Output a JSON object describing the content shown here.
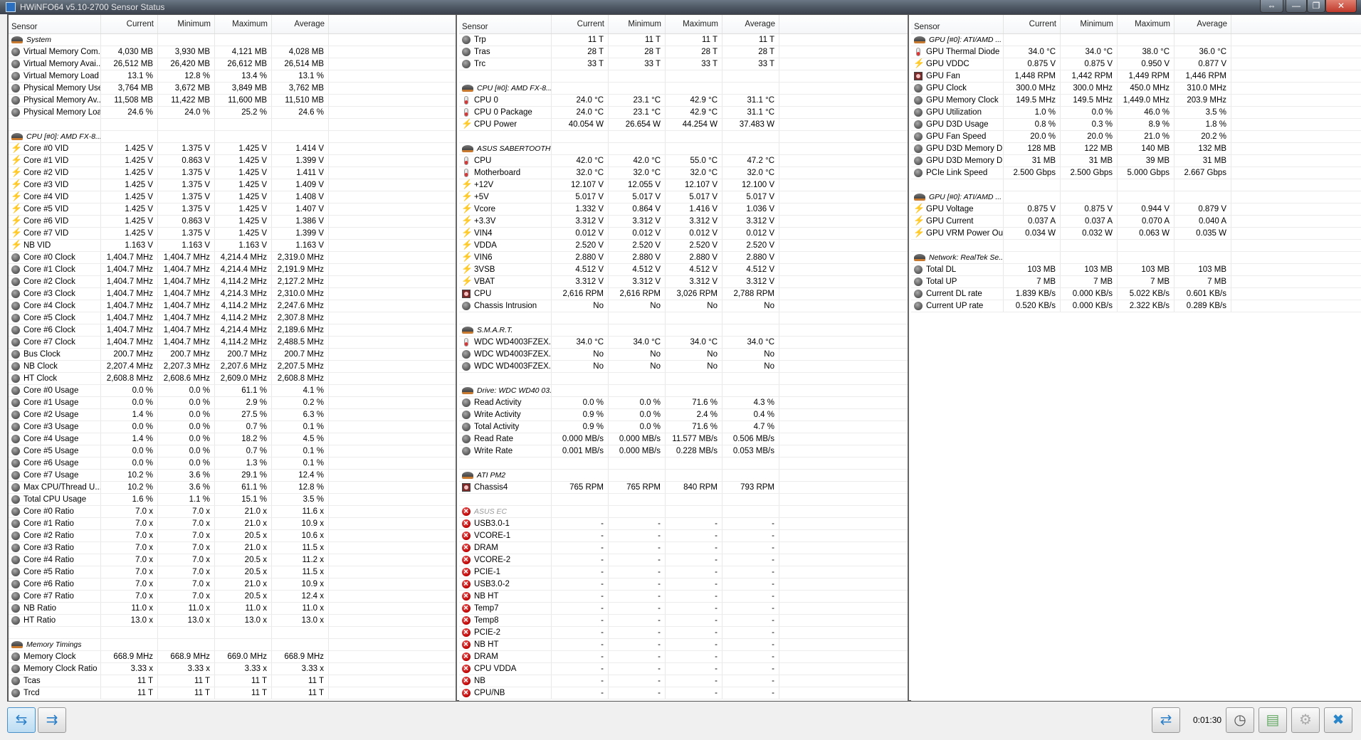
{
  "window": {
    "title": "HWiNFO64 v5.10-2700 Sensor Status",
    "btn_resize": "⇔",
    "btn_min": "—",
    "btn_max": "❐",
    "btn_close": "✕"
  },
  "columns": [
    "Sensor",
    "Current",
    "Minimum",
    "Maximum",
    "Average"
  ],
  "panels": [
    {
      "rows": [
        [
          "S",
          "System"
        ],
        [
          "g",
          "Virtual Memory Com...",
          "4,030 MB",
          "3,930 MB",
          "4,121 MB",
          "4,028 MB"
        ],
        [
          "g",
          "Virtual Memory Avai...",
          "26,512 MB",
          "26,420 MB",
          "26,612 MB",
          "26,514 MB"
        ],
        [
          "g",
          "Virtual Memory Load",
          "13.1 %",
          "12.8 %",
          "13.4 %",
          "13.1 %"
        ],
        [
          "g",
          "Physical Memory Used",
          "3,764 MB",
          "3,672 MB",
          "3,849 MB",
          "3,762 MB"
        ],
        [
          "g",
          "Physical Memory Av...",
          "11,508 MB",
          "11,422 MB",
          "11,600 MB",
          "11,510 MB"
        ],
        [
          "g",
          "Physical Memory Load",
          "24.6 %",
          "24.0 %",
          "25.2 %",
          "24.6 %"
        ],
        [
          "E"
        ],
        [
          "S",
          "CPU [#0]: AMD FX-8..."
        ],
        [
          "b",
          "Core #0 VID",
          "1.425 V",
          "1.375 V",
          "1.425 V",
          "1.414 V"
        ],
        [
          "b",
          "Core #1 VID",
          "1.425 V",
          "0.863 V",
          "1.425 V",
          "1.399 V"
        ],
        [
          "b",
          "Core #2 VID",
          "1.425 V",
          "1.375 V",
          "1.425 V",
          "1.411 V"
        ],
        [
          "b",
          "Core #3 VID",
          "1.425 V",
          "1.375 V",
          "1.425 V",
          "1.409 V"
        ],
        [
          "b",
          "Core #4 VID",
          "1.425 V",
          "1.375 V",
          "1.425 V",
          "1.408 V"
        ],
        [
          "b",
          "Core #5 VID",
          "1.425 V",
          "1.375 V",
          "1.425 V",
          "1.407 V"
        ],
        [
          "b",
          "Core #6 VID",
          "1.425 V",
          "0.863 V",
          "1.425 V",
          "1.386 V"
        ],
        [
          "b",
          "Core #7 VID",
          "1.425 V",
          "1.375 V",
          "1.425 V",
          "1.399 V"
        ],
        [
          "b",
          "NB VID",
          "1.163 V",
          "1.163 V",
          "1.163 V",
          "1.163 V"
        ],
        [
          "g",
          "Core #0 Clock",
          "1,404.7 MHz",
          "1,404.7 MHz",
          "4,214.4 MHz",
          "2,319.0 MHz"
        ],
        [
          "g",
          "Core #1 Clock",
          "1,404.7 MHz",
          "1,404.7 MHz",
          "4,214.4 MHz",
          "2,191.9 MHz"
        ],
        [
          "g",
          "Core #2 Clock",
          "1,404.7 MHz",
          "1,404.7 MHz",
          "4,114.2 MHz",
          "2,127.2 MHz"
        ],
        [
          "g",
          "Core #3 Clock",
          "1,404.7 MHz",
          "1,404.7 MHz",
          "4,214.3 MHz",
          "2,310.0 MHz"
        ],
        [
          "g",
          "Core #4 Clock",
          "1,404.7 MHz",
          "1,404.7 MHz",
          "4,114.2 MHz",
          "2,247.6 MHz"
        ],
        [
          "g",
          "Core #5 Clock",
          "1,404.7 MHz",
          "1,404.7 MHz",
          "4,114.2 MHz",
          "2,307.8 MHz"
        ],
        [
          "g",
          "Core #6 Clock",
          "1,404.7 MHz",
          "1,404.7 MHz",
          "4,214.4 MHz",
          "2,189.6 MHz"
        ],
        [
          "g",
          "Core #7 Clock",
          "1,404.7 MHz",
          "1,404.7 MHz",
          "4,114.2 MHz",
          "2,488.5 MHz"
        ],
        [
          "g",
          "Bus Clock",
          "200.7 MHz",
          "200.7 MHz",
          "200.7 MHz",
          "200.7 MHz"
        ],
        [
          "g",
          "NB Clock",
          "2,207.4 MHz",
          "2,207.3 MHz",
          "2,207.6 MHz",
          "2,207.5 MHz"
        ],
        [
          "g",
          "HT Clock",
          "2,608.8 MHz",
          "2,608.6 MHz",
          "2,609.0 MHz",
          "2,608.8 MHz"
        ],
        [
          "g",
          "Core #0 Usage",
          "0.0 %",
          "0.0 %",
          "61.1 %",
          "4.1 %"
        ],
        [
          "g",
          "Core #1 Usage",
          "0.0 %",
          "0.0 %",
          "2.9 %",
          "0.2 %"
        ],
        [
          "g",
          "Core #2 Usage",
          "1.4 %",
          "0.0 %",
          "27.5 %",
          "6.3 %"
        ],
        [
          "g",
          "Core #3 Usage",
          "0.0 %",
          "0.0 %",
          "0.7 %",
          "0.1 %"
        ],
        [
          "g",
          "Core #4 Usage",
          "1.4 %",
          "0.0 %",
          "18.2 %",
          "4.5 %"
        ],
        [
          "g",
          "Core #5 Usage",
          "0.0 %",
          "0.0 %",
          "0.7 %",
          "0.1 %"
        ],
        [
          "g",
          "Core #6 Usage",
          "0.0 %",
          "0.0 %",
          "1.3 %",
          "0.1 %"
        ],
        [
          "g",
          "Core #7 Usage",
          "10.2 %",
          "3.6 %",
          "29.1 %",
          "12.4 %"
        ],
        [
          "g",
          "Max CPU/Thread U...",
          "10.2 %",
          "3.6 %",
          "61.1 %",
          "12.8 %"
        ],
        [
          "g",
          "Total CPU Usage",
          "1.6 %",
          "1.1 %",
          "15.1 %",
          "3.5 %"
        ],
        [
          "g",
          "Core #0 Ratio",
          "7.0 x",
          "7.0 x",
          "21.0 x",
          "11.6 x"
        ],
        [
          "g",
          "Core #1 Ratio",
          "7.0 x",
          "7.0 x",
          "21.0 x",
          "10.9 x"
        ],
        [
          "g",
          "Core #2 Ratio",
          "7.0 x",
          "7.0 x",
          "20.5 x",
          "10.6 x"
        ],
        [
          "g",
          "Core #3 Ratio",
          "7.0 x",
          "7.0 x",
          "21.0 x",
          "11.5 x"
        ],
        [
          "g",
          "Core #4 Ratio",
          "7.0 x",
          "7.0 x",
          "20.5 x",
          "11.2 x"
        ],
        [
          "g",
          "Core #5 Ratio",
          "7.0 x",
          "7.0 x",
          "20.5 x",
          "11.5 x"
        ],
        [
          "g",
          "Core #6 Ratio",
          "7.0 x",
          "7.0 x",
          "21.0 x",
          "10.9 x"
        ],
        [
          "g",
          "Core #7 Ratio",
          "7.0 x",
          "7.0 x",
          "20.5 x",
          "12.4 x"
        ],
        [
          "g",
          "NB Ratio",
          "11.0 x",
          "11.0 x",
          "11.0 x",
          "11.0 x"
        ],
        [
          "g",
          "HT Ratio",
          "13.0 x",
          "13.0 x",
          "13.0 x",
          "13.0 x"
        ],
        [
          "E"
        ],
        [
          "S",
          "Memory Timings"
        ],
        [
          "g",
          "Memory Clock",
          "668.9 MHz",
          "668.9 MHz",
          "669.0 MHz",
          "668.9 MHz"
        ],
        [
          "g",
          "Memory Clock Ratio",
          "3.33 x",
          "3.33 x",
          "3.33 x",
          "3.33 x"
        ],
        [
          "g",
          "Tcas",
          "11 T",
          "11 T",
          "11 T",
          "11 T"
        ],
        [
          "g",
          "Trcd",
          "11 T",
          "11 T",
          "11 T",
          "11 T"
        ]
      ]
    },
    {
      "rows": [
        [
          "g",
          "Trp",
          "11 T",
          "11 T",
          "11 T",
          "11 T"
        ],
        [
          "g",
          "Tras",
          "28 T",
          "28 T",
          "28 T",
          "28 T"
        ],
        [
          "g",
          "Trc",
          "33 T",
          "33 T",
          "33 T",
          "33 T"
        ],
        [
          "E"
        ],
        [
          "S",
          "CPU [#0]: AMD FX-8..."
        ],
        [
          "t",
          "CPU 0",
          "24.0 °C",
          "23.1 °C",
          "42.9 °C",
          "31.1 °C"
        ],
        [
          "t",
          "CPU 0 Package",
          "24.0 °C",
          "23.1 °C",
          "42.9 °C",
          "31.1 °C"
        ],
        [
          "b",
          "CPU Power",
          "40.054 W",
          "26.654 W",
          "44.254 W",
          "37.483 W"
        ],
        [
          "E"
        ],
        [
          "S",
          "ASUS SABERTOOTH ..."
        ],
        [
          "t",
          "CPU",
          "42.0 °C",
          "42.0 °C",
          "55.0 °C",
          "47.2 °C"
        ],
        [
          "t",
          "Motherboard",
          "32.0 °C",
          "32.0 °C",
          "32.0 °C",
          "32.0 °C"
        ],
        [
          "b",
          "+12V",
          "12.107 V",
          "12.055 V",
          "12.107 V",
          "12.100 V"
        ],
        [
          "b",
          "+5V",
          "5.017 V",
          "5.017 V",
          "5.017 V",
          "5.017 V"
        ],
        [
          "b",
          "Vcore",
          "1.332 V",
          "0.864 V",
          "1.416 V",
          "1.036 V"
        ],
        [
          "b",
          "+3.3V",
          "3.312 V",
          "3.312 V",
          "3.312 V",
          "3.312 V"
        ],
        [
          "b",
          "VIN4",
          "0.012 V",
          "0.012 V",
          "0.012 V",
          "0.012 V"
        ],
        [
          "b",
          "VDDA",
          "2.520 V",
          "2.520 V",
          "2.520 V",
          "2.520 V"
        ],
        [
          "b",
          "VIN6",
          "2.880 V",
          "2.880 V",
          "2.880 V",
          "2.880 V"
        ],
        [
          "b",
          "3VSB",
          "4.512 V",
          "4.512 V",
          "4.512 V",
          "4.512 V"
        ],
        [
          "b",
          "VBAT",
          "3.312 V",
          "3.312 V",
          "3.312 V",
          "3.312 V"
        ],
        [
          "f",
          "CPU",
          "2,616 RPM",
          "2,616 RPM",
          "3,026 RPM",
          "2,788 RPM"
        ],
        [
          "g",
          "Chassis Intrusion",
          "No",
          "No",
          "No",
          "No"
        ],
        [
          "E"
        ],
        [
          "S",
          "S.M.A.R.T."
        ],
        [
          "t",
          "WDC WD4003FZEX...",
          "34.0 °C",
          "34.0 °C",
          "34.0 °C",
          "34.0 °C"
        ],
        [
          "g",
          "WDC WD4003FZEX...",
          "No",
          "No",
          "No",
          "No"
        ],
        [
          "g",
          "WDC WD4003FZEX...",
          "No",
          "No",
          "No",
          "No"
        ],
        [
          "E"
        ],
        [
          "S",
          "Drive: WDC WD40 03..."
        ],
        [
          "g",
          "Read Activity",
          "0.0 %",
          "0.0 %",
          "71.6 %",
          "4.3 %"
        ],
        [
          "g",
          "Write Activity",
          "0.9 %",
          "0.0 %",
          "2.4 %",
          "0.4 %"
        ],
        [
          "g",
          "Total Activity",
          "0.9 %",
          "0.0 %",
          "71.6 %",
          "4.7 %"
        ],
        [
          "g",
          "Read Rate",
          "0.000 MB/s",
          "0.000 MB/s",
          "11.577 MB/s",
          "0.506 MB/s"
        ],
        [
          "g",
          "Write Rate",
          "0.001 MB/s",
          "0.000 MB/s",
          "0.228 MB/s",
          "0.053 MB/s"
        ],
        [
          "E"
        ],
        [
          "S",
          "ATI PM2"
        ],
        [
          "f",
          "Chassis4",
          "765 RPM",
          "765 RPM",
          "840 RPM",
          "793 RPM"
        ],
        [
          "E"
        ],
        [
          "D",
          "ASUS EC"
        ],
        [
          "x",
          "USB3.0-1",
          "-",
          "-",
          "-",
          "-"
        ],
        [
          "x",
          "VCORE-1",
          "-",
          "-",
          "-",
          "-"
        ],
        [
          "x",
          "DRAM",
          "-",
          "-",
          "-",
          "-"
        ],
        [
          "x",
          "VCORE-2",
          "-",
          "-",
          "-",
          "-"
        ],
        [
          "x",
          "PCIE-1",
          "-",
          "-",
          "-",
          "-"
        ],
        [
          "x",
          "USB3.0-2",
          "-",
          "-",
          "-",
          "-"
        ],
        [
          "x",
          "NB HT",
          "-",
          "-",
          "-",
          "-"
        ],
        [
          "x",
          "Temp7",
          "-",
          "-",
          "-",
          "-"
        ],
        [
          "x",
          "Temp8",
          "-",
          "-",
          "-",
          "-"
        ],
        [
          "x",
          "PCIE-2",
          "-",
          "-",
          "-",
          "-"
        ],
        [
          "x",
          "NB HT",
          "-",
          "-",
          "-",
          "-"
        ],
        [
          "x",
          "DRAM",
          "-",
          "-",
          "-",
          "-"
        ],
        [
          "x",
          "CPU VDDA",
          "-",
          "-",
          "-",
          "-"
        ],
        [
          "x",
          "NB",
          "-",
          "-",
          "-",
          "-"
        ],
        [
          "x",
          "CPU/NB",
          "-",
          "-",
          "-",
          "-"
        ]
      ]
    },
    {
      "rows": [
        [
          "S",
          "GPU [#0]: ATI/AMD ..."
        ],
        [
          "t",
          "GPU Thermal Diode",
          "34.0 °C",
          "34.0 °C",
          "38.0 °C",
          "36.0 °C"
        ],
        [
          "b",
          "GPU VDDC",
          "0.875 V",
          "0.875 V",
          "0.950 V",
          "0.877 V"
        ],
        [
          "f",
          "GPU Fan",
          "1,448 RPM",
          "1,442 RPM",
          "1,449 RPM",
          "1,446 RPM"
        ],
        [
          "g",
          "GPU Clock",
          "300.0 MHz",
          "300.0 MHz",
          "450.0 MHz",
          "310.0 MHz"
        ],
        [
          "g",
          "GPU Memory Clock",
          "149.5 MHz",
          "149.5 MHz",
          "1,449.0 MHz",
          "203.9 MHz"
        ],
        [
          "g",
          "GPU Utilization",
          "1.0 %",
          "0.0 %",
          "46.0 %",
          "3.5 %"
        ],
        [
          "g",
          "GPU D3D Usage",
          "0.8 %",
          "0.3 %",
          "8.9 %",
          "1.8 %"
        ],
        [
          "g",
          "GPU Fan Speed",
          "20.0 %",
          "20.0 %",
          "21.0 %",
          "20.2 %"
        ],
        [
          "g",
          "GPU D3D Memory D...",
          "128 MB",
          "122 MB",
          "140 MB",
          "132 MB"
        ],
        [
          "g",
          "GPU D3D Memory D...",
          "31 MB",
          "31 MB",
          "39 MB",
          "31 MB"
        ],
        [
          "g",
          "PCIe Link Speed",
          "2.500 Gbps",
          "2.500 Gbps",
          "5.000 Gbps",
          "2.667 Gbps"
        ],
        [
          "E"
        ],
        [
          "S",
          "GPU [#0]: ATI/AMD ..."
        ],
        [
          "b",
          "GPU Voltage",
          "0.875 V",
          "0.875 V",
          "0.944 V",
          "0.879 V"
        ],
        [
          "b",
          "GPU Current",
          "0.037 A",
          "0.037 A",
          "0.070 A",
          "0.040 A"
        ],
        [
          "b",
          "GPU VRM Power Ou...",
          "0.034 W",
          "0.032 W",
          "0.063 W",
          "0.035 W"
        ],
        [
          "E"
        ],
        [
          "S",
          "Network: RealTek Se..."
        ],
        [
          "g",
          "Total DL",
          "103 MB",
          "103 MB",
          "103 MB",
          "103 MB"
        ],
        [
          "g",
          "Total UP",
          "7 MB",
          "7 MB",
          "7 MB",
          "7 MB"
        ],
        [
          "g",
          "Current DL rate",
          "1.839 KB/s",
          "0.000 KB/s",
          "5.022 KB/s",
          "0.601 KB/s"
        ],
        [
          "g",
          "Current UP rate",
          "0.520 KB/s",
          "0.000 KB/s",
          "2.322 KB/s",
          "0.289 KB/s"
        ]
      ]
    }
  ],
  "toolbar": {
    "expand_icon": "⇆",
    "collapse_icon": "⇉",
    "network_icon": "⇄",
    "timer": "0:01:30",
    "clock_icon": "◷",
    "report_icon": "▤",
    "settings_icon": "⚙",
    "close_icon": "✖"
  }
}
